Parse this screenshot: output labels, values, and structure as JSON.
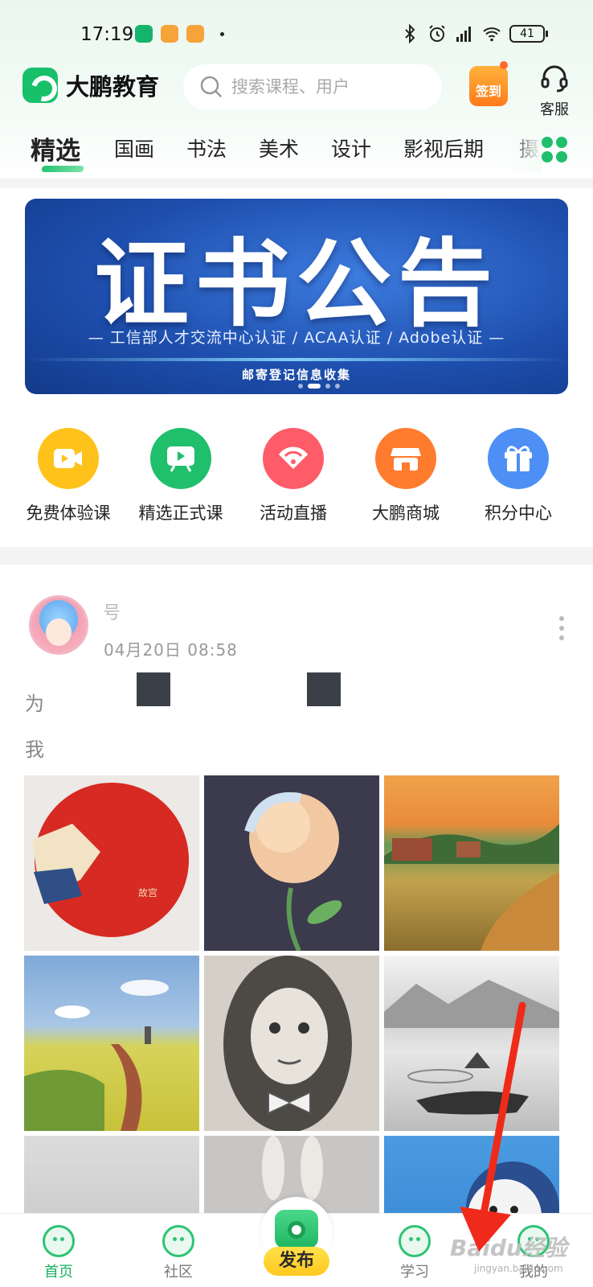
{
  "status_bar": {
    "time": "17:19",
    "battery": "41"
  },
  "header": {
    "brand": "大鹏教育",
    "search_placeholder": "搜索课程、用户",
    "checkin_label": "签到",
    "service_label": "客服"
  },
  "category_tabs": [
    "精选",
    "国画",
    "书法",
    "美术",
    "设计",
    "影视后期",
    "摄"
  ],
  "banner": {
    "title": "证书公告",
    "subtitle": "— 工信部人才交流中心认证 / ACAA认证 / Adobe认证 —",
    "note": "邮寄登记信息收集",
    "page_count": 4,
    "active_page": 2
  },
  "quick_entries": [
    {
      "label": "免费体验课",
      "icon": "video-play-icon",
      "color": "#ffc21a"
    },
    {
      "label": "精选正式课",
      "icon": "screen-play-icon",
      "color": "#1fbf6b"
    },
    {
      "label": "活动直播",
      "icon": "broadcast-icon",
      "color": "#ff5c6a"
    },
    {
      "label": "大鹏商城",
      "icon": "store-icon",
      "color": "#ff7b2e"
    },
    {
      "label": "积分中心",
      "icon": "gift-icon",
      "color": "#4d8ff5"
    }
  ],
  "post": {
    "username": "号",
    "date": "04月20日",
    "time": "08:58",
    "text_line1": "为",
    "text_line2": "我"
  },
  "bottom_nav": {
    "home": "首页",
    "community": "社区",
    "publish": "发布",
    "study": "学习",
    "mine": "我的"
  },
  "watermark": {
    "brand": "Baidu经验",
    "url": "jingyan.baidu.com"
  },
  "colors": {
    "accent": "#1fbf6b",
    "banner_blue": "#1e4fae",
    "publish_yellow": "#ffcf2a",
    "annotation_arrow": "#f02a1a"
  }
}
